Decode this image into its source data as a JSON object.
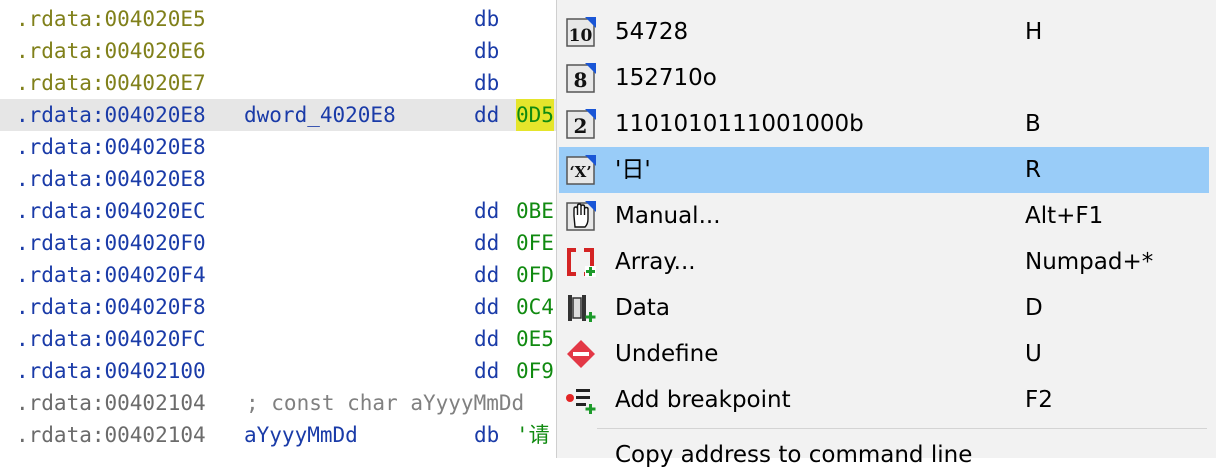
{
  "code_rows": [
    {
      "addr": ".rdata:004020E5",
      "addr_style": "c-addr1",
      "name": "",
      "instr": "db",
      "value": "",
      "value_hl": false,
      "comment": ""
    },
    {
      "addr": ".rdata:004020E6",
      "addr_style": "c-addr1",
      "name": "",
      "instr": "db",
      "value": "",
      "value_hl": false,
      "comment": ""
    },
    {
      "addr": ".rdata:004020E7",
      "addr_style": "c-addr1",
      "name": "",
      "instr": "db",
      "value": "",
      "value_hl": false,
      "comment": ""
    },
    {
      "addr": ".rdata:004020E8",
      "addr_style": "c-addr2",
      "name": "dword_4020E8",
      "instr": "dd",
      "value": "0D5",
      "value_hl": true,
      "comment": "",
      "highlight_row": true
    },
    {
      "addr": ".rdata:004020E8",
      "addr_style": "c-addr2",
      "name": "",
      "instr": "",
      "value": "",
      "value_hl": false,
      "comment": ""
    },
    {
      "addr": ".rdata:004020E8",
      "addr_style": "c-addr2",
      "name": "",
      "instr": "",
      "value": "",
      "value_hl": false,
      "comment": ""
    },
    {
      "addr": ".rdata:004020EC",
      "addr_style": "c-addr2",
      "name": "",
      "instr": "dd",
      "value": "0BE",
      "value_hl": false,
      "comment": ""
    },
    {
      "addr": ".rdata:004020F0",
      "addr_style": "c-addr2",
      "name": "",
      "instr": "dd",
      "value": "0FE",
      "value_hl": false,
      "comment": ""
    },
    {
      "addr": ".rdata:004020F4",
      "addr_style": "c-addr2",
      "name": "",
      "instr": "dd",
      "value": "0FD",
      "value_hl": false,
      "comment": ""
    },
    {
      "addr": ".rdata:004020F8",
      "addr_style": "c-addr2",
      "name": "",
      "instr": "dd",
      "value": "0C4",
      "value_hl": false,
      "comment": ""
    },
    {
      "addr": ".rdata:004020FC",
      "addr_style": "c-addr2",
      "name": "",
      "instr": "dd",
      "value": "0E5",
      "value_hl": false,
      "comment": ""
    },
    {
      "addr": ".rdata:00402100",
      "addr_style": "c-addr2",
      "name": "",
      "instr": "dd",
      "value": "0F9",
      "value_hl": false,
      "comment": ""
    },
    {
      "addr": ".rdata:00402104",
      "addr_style": "c-addr3",
      "name": "",
      "instr": "",
      "value": "",
      "value_hl": false,
      "comment": "; const char aYyyyMmDd"
    },
    {
      "addr": ".rdata:00402104",
      "addr_style": "c-addr3",
      "name": "aYyyyMmDd",
      "instr": "db",
      "value": "'请",
      "value_hl": false,
      "comment": ""
    }
  ],
  "menu": {
    "items": [
      {
        "icon": "decimal-10-icon",
        "icon_text": "10",
        "label": "54728",
        "shortcut": "H",
        "selected": false
      },
      {
        "icon": "octal-8-icon",
        "icon_text": "8",
        "label": "152710o",
        "shortcut": "",
        "selected": false
      },
      {
        "icon": "binary-2-icon",
        "icon_text": "2",
        "label": "1101010111001000b",
        "shortcut": "B",
        "selected": false
      },
      {
        "icon": "char-x-icon",
        "icon_text": "'X'",
        "label": "'日'",
        "shortcut": "R",
        "selected": true
      },
      {
        "icon": "manual-hand-icon",
        "icon_text": "",
        "label": "Manual...",
        "shortcut": "Alt+F1",
        "selected": false
      },
      {
        "icon": "array-icon",
        "icon_text": "",
        "label": "Array...",
        "shortcut": "Numpad+*",
        "selected": false
      },
      {
        "icon": "data-icon",
        "icon_text": "",
        "label": "Data",
        "shortcut": "D",
        "selected": false
      },
      {
        "icon": "undefine-icon",
        "icon_text": "",
        "label": "Undefine",
        "shortcut": "U",
        "selected": false
      },
      {
        "icon": "add-breakpoint-icon",
        "icon_text": "",
        "label": "Add breakpoint",
        "shortcut": "F2",
        "selected": false
      }
    ],
    "cut_item": "Copy address to command line"
  }
}
